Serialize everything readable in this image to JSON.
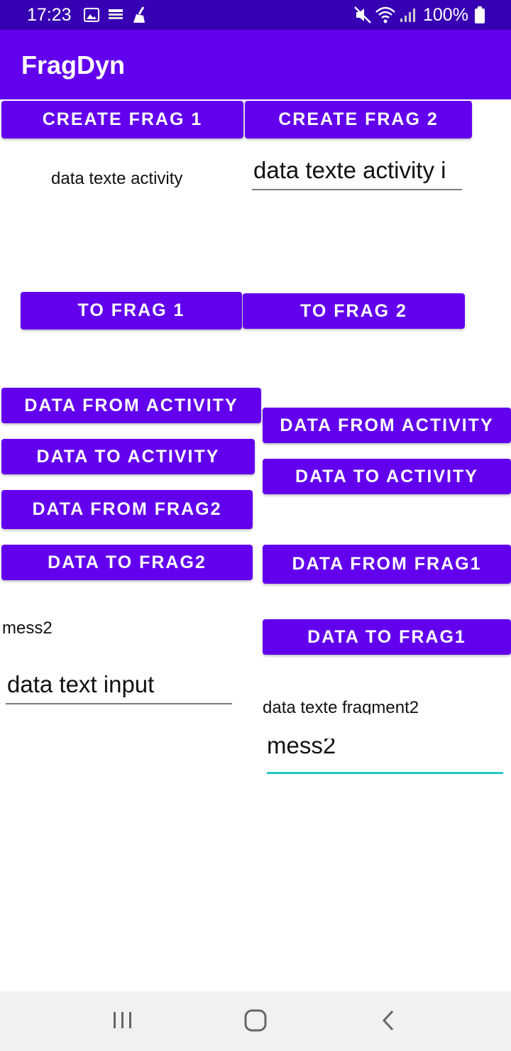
{
  "status_bar": {
    "time": "17:23",
    "battery": "100%",
    "icons": [
      "image-icon",
      "notification-icon",
      "cleaner-icon",
      "mute-icon",
      "wifi-icon",
      "signal-icon",
      "battery-icon"
    ]
  },
  "app_bar": {
    "title": "FragDyn"
  },
  "activity": {
    "create_frag1": "CREATE FRAG 1",
    "create_frag2": "CREATE FRAG 2",
    "label": "data texte activity",
    "input_value": "data texte activity i",
    "to_frag1": "TO FRAG 1",
    "to_frag2": "TO FRAG 2"
  },
  "fragment1": {
    "data_from_activity": "DATA FROM ACTIVITY",
    "data_to_activity": "DATA TO ACTIVITY",
    "data_from_frag2": "DATA FROM FRAG2",
    "data_to_frag2": "DATA TO FRAG2",
    "message": "mess2",
    "input_value": "data text input"
  },
  "fragment2": {
    "data_from_activity": "DATA FROM ACTIVITY",
    "data_to_activity": "DATA TO ACTIVITY",
    "data_from_frag1": "DATA FROM FRAG1",
    "data_to_frag1": "DATA TO FRAG1",
    "label": "data texte fragment2",
    "input_value": "mess2"
  },
  "colors": {
    "primary": "#6200ee",
    "primary_dark": "#3700b3",
    "focus_underline": "#26c6c6"
  }
}
